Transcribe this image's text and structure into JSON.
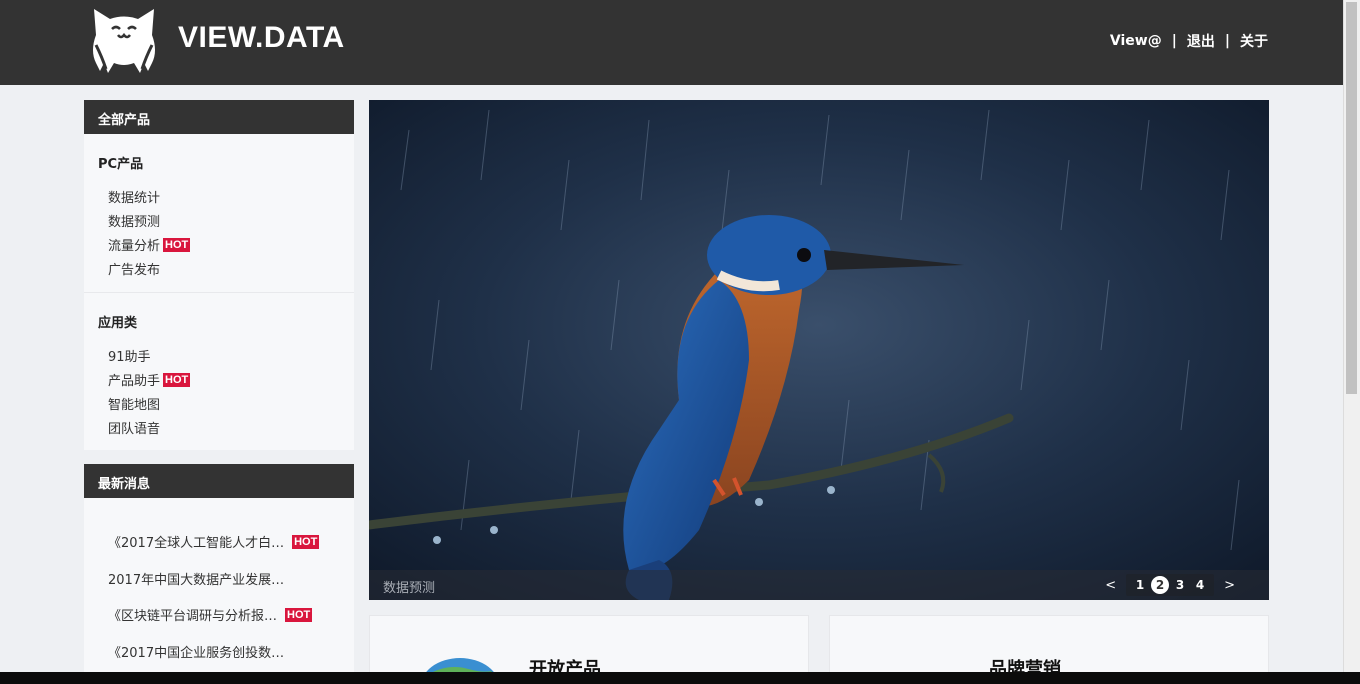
{
  "header": {
    "brand": "VIEW.DATA",
    "nav": [
      {
        "label": "View@"
      },
      {
        "label": "退出"
      },
      {
        "label": "关于"
      }
    ],
    "separator": "|"
  },
  "sidebar": {
    "products_panel": {
      "title": "全部产品",
      "groups": [
        {
          "title": "PC产品",
          "items": [
            {
              "label": "数据统计",
              "hot": false
            },
            {
              "label": "数据预测",
              "hot": false
            },
            {
              "label": "流量分析",
              "hot": true
            },
            {
              "label": "广告发布",
              "hot": false
            }
          ]
        },
        {
          "title": "应用类",
          "items": [
            {
              "label": "91助手",
              "hot": false
            },
            {
              "label": "产品助手",
              "hot": true
            },
            {
              "label": "智能地图",
              "hot": false
            },
            {
              "label": "团队语音",
              "hot": false
            }
          ]
        }
      ]
    },
    "news_panel": {
      "title": "最新消息",
      "items": [
        {
          "label": "《2017全球人工智能人才白…",
          "hot": true
        },
        {
          "label": "2017年中国大数据产业发展…",
          "hot": false
        },
        {
          "label": "《区块链平台调研与分析报…",
          "hot": true
        },
        {
          "label": "《2017中国企业服务创投数…",
          "hot": false
        }
      ]
    },
    "hot_badge": "HOT"
  },
  "banner": {
    "caption": "数据预测",
    "prev": "<",
    "next": ">",
    "pages": [
      "1",
      "2",
      "3",
      "4"
    ],
    "active_page": "2"
  },
  "cards": [
    {
      "title": "开放产品",
      "icon": "globe-icon"
    },
    {
      "title": "品牌营销",
      "icon": "marketing-icon"
    }
  ],
  "colors": {
    "header_bg": "#333333",
    "hot_badge": "#d9163d",
    "page_bg": "#eef0f3"
  }
}
